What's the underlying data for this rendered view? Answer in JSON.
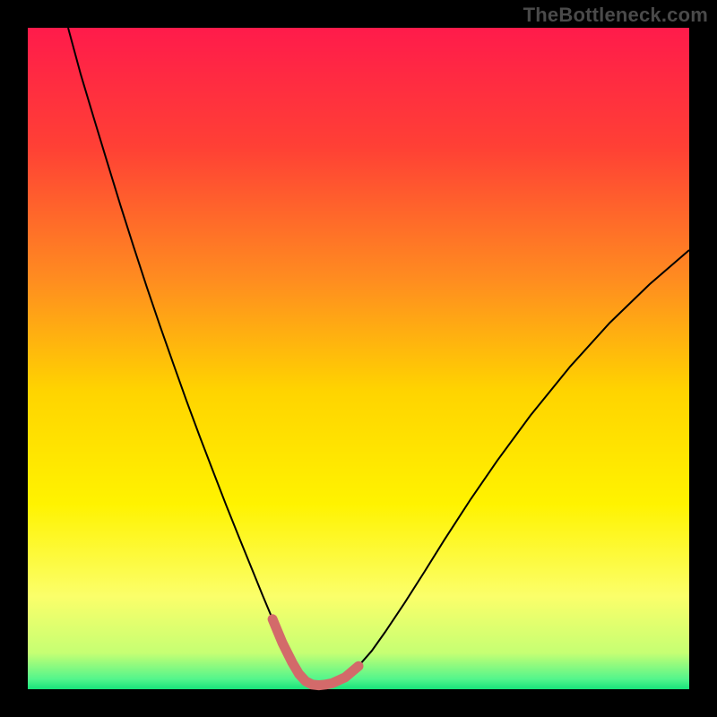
{
  "watermark": {
    "text": "TheBottleneck.com"
  },
  "chart_data": {
    "type": "line",
    "title": "",
    "xlabel": "",
    "ylabel": "",
    "xlim": [
      0,
      100
    ],
    "ylim": [
      0,
      100
    ],
    "grid": false,
    "background": {
      "type": "vertical-gradient",
      "stops": [
        {
          "offset": 0.0,
          "color": "#ff1b4b"
        },
        {
          "offset": 0.18,
          "color": "#ff4035"
        },
        {
          "offset": 0.38,
          "color": "#ff8c20"
        },
        {
          "offset": 0.55,
          "color": "#ffd400"
        },
        {
          "offset": 0.72,
          "color": "#fff300"
        },
        {
          "offset": 0.86,
          "color": "#fbff6a"
        },
        {
          "offset": 0.945,
          "color": "#c6ff73"
        },
        {
          "offset": 0.985,
          "color": "#52f58c"
        },
        {
          "offset": 1.0,
          "color": "#17e37a"
        }
      ]
    },
    "series": [
      {
        "name": "bottleneck-curve",
        "color": "#000000",
        "stroke_width": 2,
        "x": [
          6.1,
          8,
          10,
          12,
          14,
          16,
          18,
          20,
          22,
          24,
          26,
          28,
          30,
          32,
          34,
          35.5,
          37,
          38.5,
          40,
          41,
          42,
          43,
          44,
          45,
          46,
          48,
          50,
          52,
          54,
          57,
          60,
          63,
          67,
          71,
          76,
          82,
          88,
          94,
          100
        ],
        "y": [
          100,
          93,
          86.3,
          79.7,
          73.2,
          66.9,
          60.8,
          54.9,
          49.2,
          43.6,
          38.2,
          33,
          27.8,
          22.8,
          17.9,
          14.2,
          10.6,
          7,
          4,
          2.3,
          1.2,
          0.7,
          0.6,
          0.7,
          0.9,
          1.8,
          3.5,
          5.8,
          8.6,
          13.1,
          17.8,
          22.6,
          28.8,
          34.6,
          41.4,
          48.8,
          55.4,
          61.2,
          66.4
        ]
      },
      {
        "name": "valley-highlight",
        "color": "#d36a6a",
        "stroke_width": 11,
        "linecap": "round",
        "x": [
          37,
          38.5,
          40,
          41,
          42,
          43,
          44,
          45,
          46,
          48,
          50
        ],
        "y": [
          10.6,
          7,
          4,
          2.3,
          1.2,
          0.7,
          0.6,
          0.7,
          0.9,
          1.8,
          3.5
        ]
      }
    ],
    "annotations": [
      {
        "type": "min",
        "x": 44,
        "y": 0.6,
        "label": ""
      }
    ]
  }
}
